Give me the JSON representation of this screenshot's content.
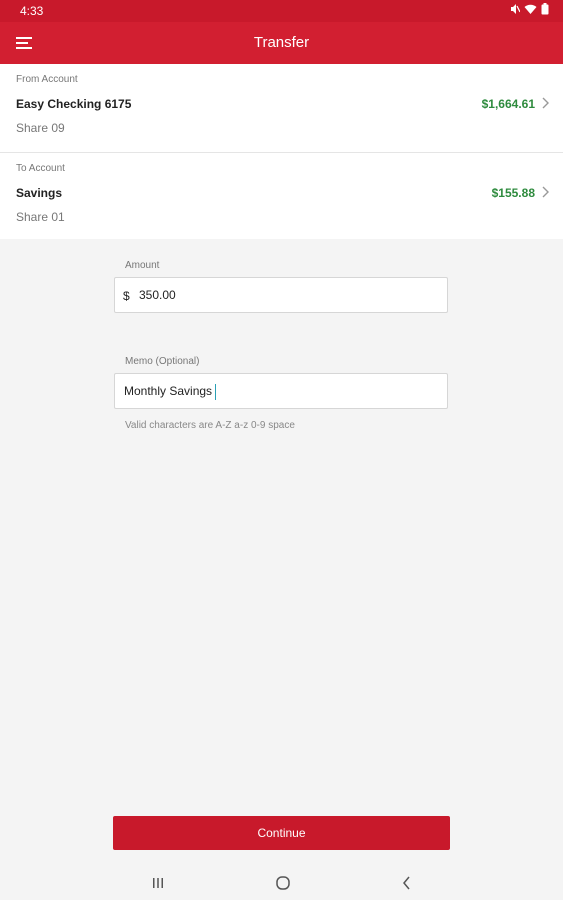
{
  "status_bar": {
    "time": "4:33",
    "icons": [
      "mute-icon",
      "wifi-icon",
      "battery-icon"
    ]
  },
  "app_bar": {
    "title": "Transfer",
    "menu_icon": "hamburger-menu-icon"
  },
  "from_account": {
    "caption": "From Account",
    "name": "Easy Checking 6175",
    "share": "Share 09",
    "balance": "$1,664.61"
  },
  "to_account": {
    "caption": "To Account",
    "name": "Savings",
    "share": "Share 01",
    "balance": "$155.88"
  },
  "amount": {
    "label": "Amount",
    "currency": "$",
    "value": "350.00"
  },
  "memo": {
    "label": "Memo (Optional)",
    "value": "Monthly Savings",
    "hint": "Valid characters are A-Z a-z 0-9 space"
  },
  "continue_label": "Continue",
  "colors": {
    "primary_red": "#d21f31",
    "balance_green": "#2e8b3e",
    "background": "#f4f4f4"
  },
  "nav_bar": {
    "icons": [
      "recent-apps-icon",
      "home-icon",
      "back-icon"
    ]
  }
}
